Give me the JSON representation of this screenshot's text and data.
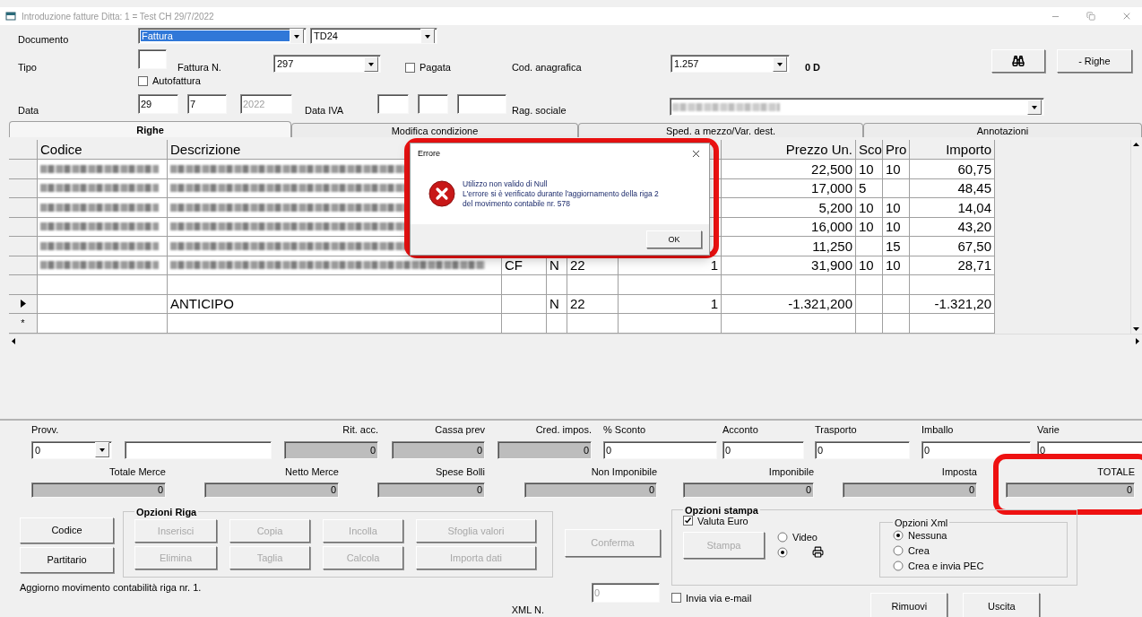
{
  "window": {
    "title": "Introduzione fatture  Ditta: 1 = Test CH  29/7/2022"
  },
  "header": {
    "documento_label": "Documento",
    "documento_select": {
      "value": "Fattura",
      "selected": true
    },
    "td_select": {
      "value": "TD24"
    },
    "tipo_label": "Tipo",
    "fattura_n_label": "Fattura N.",
    "fattura_n_select": {
      "value": "297"
    },
    "pagata": {
      "label": "Pagata",
      "checked": false
    },
    "cod_anagrafica_label": "Cod. anagrafica",
    "cod_anagrafica_select": {
      "value": "1.257"
    },
    "saldo": "0 D",
    "righe_button": {
      "label": "- Righe"
    },
    "autofattura": {
      "label": "Autofattura",
      "checked": false
    },
    "data_label": "Data",
    "data": [
      {
        "value": "29",
        "disabled": false
      },
      {
        "value": "7",
        "disabled": false
      },
      {
        "value": "2022",
        "disabled": true
      }
    ],
    "data_iva_label": "Data IVA",
    "rag_sociale_label": "Rag. sociale",
    "rag_sociale_select": {
      "kind": "blurred"
    }
  },
  "tabs": [
    {
      "label": "Righe",
      "selected": true
    },
    {
      "label": "Modifica condizione",
      "selected": false
    },
    {
      "label": "Sped. a mezzo/Var. dest.",
      "selected": false
    },
    {
      "label": "Annotazioni",
      "selected": false
    }
  ],
  "grid": {
    "columns": [
      {
        "header": "Codice"
      },
      {
        "header": "Descrizione"
      },
      {},
      {},
      {},
      {},
      {
        "header": "Prezzo Un."
      },
      {
        "header": "Sco"
      },
      {
        "header": "Pro"
      },
      {
        "header": "Importo"
      }
    ],
    "rows": [
      {
        "current": false,
        "cells": [
          {
            "kind": "blurred"
          },
          {
            "kind": "blurred"
          },
          null,
          null,
          null,
          null,
          "22,500",
          "10",
          "10",
          "60,75"
        ]
      },
      {
        "current": false,
        "cells": [
          {
            "kind": "blurred"
          },
          {
            "kind": "blurred"
          },
          null,
          null,
          null,
          null,
          "17,000",
          "5",
          null,
          "48,45"
        ]
      },
      {
        "current": false,
        "cells": [
          {
            "kind": "blurred"
          },
          {
            "kind": "blurred"
          },
          null,
          null,
          null,
          null,
          "5,200",
          "10",
          "10",
          "14,04"
        ]
      },
      {
        "current": false,
        "cells": [
          {
            "kind": "blurred"
          },
          {
            "kind": "blurred"
          },
          null,
          null,
          null,
          null,
          "16,000",
          "10",
          "10",
          "43,20"
        ]
      },
      {
        "current": false,
        "cells": [
          {
            "kind": "blurred"
          },
          {
            "kind": "blurred"
          },
          null,
          null,
          null,
          null,
          "11,250",
          null,
          "15",
          "67,50"
        ]
      },
      {
        "current": false,
        "cells": [
          {
            "kind": "blurred"
          },
          {
            "kind": "blurred"
          },
          "CF",
          "N",
          "22",
          "1",
          "31,900",
          "10",
          "10",
          "28,71"
        ]
      },
      {
        "current": false
      },
      {
        "current": true,
        "cells": [
          null,
          "ANTICIPO",
          null,
          "N",
          "22",
          "1",
          "-1.321,200",
          null,
          null,
          "-1.321,20"
        ]
      },
      {
        "current": false,
        "marker": "*"
      }
    ]
  },
  "charges": [
    {
      "label": "Provv.",
      "kind": "select",
      "value": "0"
    },
    {
      "kind": "input"
    },
    {
      "label": "Rit. acc.",
      "kind": "readonly",
      "value": "0"
    },
    {
      "label": "Cassa prev",
      "kind": "readonly",
      "value": "0"
    },
    {
      "label": "Cred. impos.",
      "kind": "readonly",
      "value": "0"
    },
    {
      "label": "% Sconto",
      "kind": "input",
      "value": "0"
    },
    {
      "label": "Acconto",
      "kind": "input",
      "value": "0"
    },
    {
      "label": "Trasporto",
      "kind": "input",
      "value": "0"
    },
    {
      "label": "Imballo",
      "kind": "input",
      "value": "0"
    },
    {
      "label": "Varie",
      "kind": "input",
      "value": "0"
    }
  ],
  "totals": [
    {
      "label": "Totale Merce",
      "value": "0"
    },
    {
      "label": "Netto Merce",
      "value": "0"
    },
    {
      "label": "Spese Bolli",
      "value": "0"
    },
    {
      "label": "Non Imponibile",
      "value": "0"
    },
    {
      "label": "Imponibile",
      "value": "0"
    },
    {
      "label": "Imposta",
      "value": "0"
    },
    {
      "label": "TOTALE",
      "value": "0",
      "highlighted": true
    }
  ],
  "side_buttons": [
    {
      "label": "Codice",
      "disabled": false
    },
    {
      "label": "Partitario",
      "disabled": false
    }
  ],
  "status": "Aggiorno movimento contabilità riga nr. 1.",
  "row_options": {
    "title": "Opzioni Riga",
    "buttons": [
      {
        "label": "Inserisci",
        "disabled": true
      },
      {
        "label": "Copia",
        "disabled": true
      },
      {
        "label": "Incolla",
        "disabled": true
      },
      {
        "label": "Sfoglia valori",
        "disabled": true
      },
      {
        "label": "Elimina",
        "disabled": true
      },
      {
        "label": "Taglia",
        "disabled": true
      },
      {
        "label": "Calcola",
        "disabled": true
      },
      {
        "label": "Importa dati",
        "disabled": true
      }
    ]
  },
  "confirm_button": {
    "label": "Conferma",
    "disabled": true
  },
  "xml_number": {
    "label": "XML N.",
    "value": "0"
  },
  "print_options": {
    "title": "Opzioni stampa",
    "valuta_euro": {
      "label": "Valuta Euro",
      "checked": true
    },
    "print_button": {
      "label": "Stampa",
      "disabled": true
    },
    "outputs": [
      {
        "kind": "video",
        "label": "Video",
        "selected": false
      },
      {
        "kind": "printer",
        "selected": true
      }
    ],
    "xml": {
      "title": "Opzioni Xml",
      "options": [
        {
          "label": "Nessuna",
          "selected": true
        },
        {
          "label": "Crea",
          "selected": false
        },
        {
          "label": "Crea e invia PEC",
          "selected": false
        }
      ]
    }
  },
  "send_email": {
    "label": "Invia via e-mail",
    "checked": false
  },
  "footer_buttons": [
    {
      "label": "Rimuovi"
    },
    {
      "label": "Uscita"
    }
  ],
  "dialog": {
    "title": "Errore",
    "message": [
      "Utilizzo non valido di Null",
      "L'errore si è verificato durante l'aggiornamento della riga 2",
      "del movimento contabile nr. 578"
    ],
    "button": "OK",
    "highlighted": true
  }
}
